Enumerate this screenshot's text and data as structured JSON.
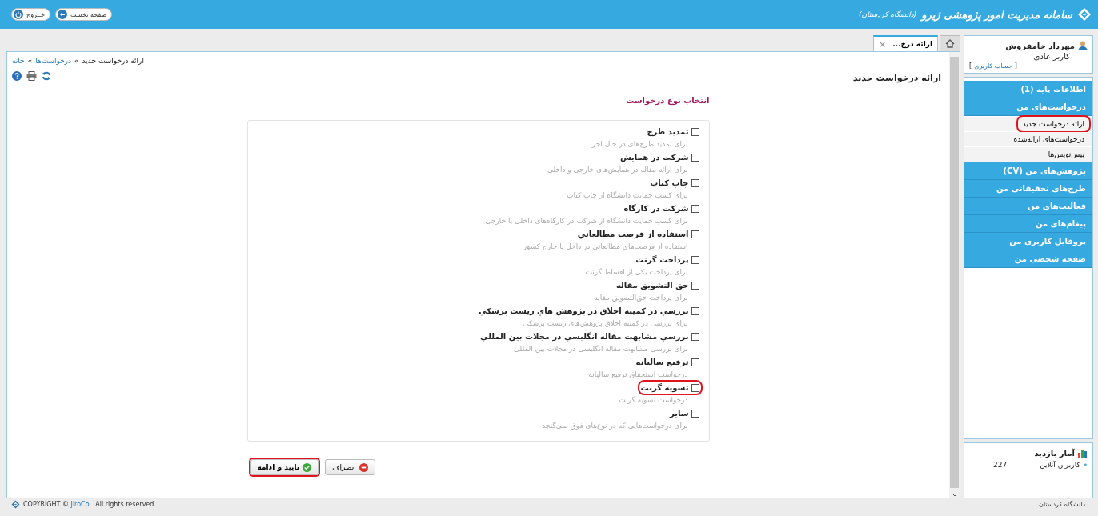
{
  "header": {
    "title": "سامانه مدیریت امور پژوهشی ژیرو",
    "subtitle": "(دانشگاه کردستان)",
    "buttons": [
      {
        "kind": "home",
        "label": "صفحه نخست"
      },
      {
        "kind": "logout",
        "label": "خــروج"
      }
    ]
  },
  "tabs": [
    {
      "kind": "home",
      "selected": false
    },
    {
      "kind": "page",
      "label": "ارائه درخ...",
      "close": "×",
      "selected": true
    }
  ],
  "breadcrumb": {
    "separator": "»",
    "items": [
      {
        "label": "ارائه درخواست جدید",
        "link": false
      },
      {
        "label": "درخواست‌ها",
        "link": true
      },
      {
        "label": "خانه",
        "link": true
      }
    ]
  },
  "page_title": "ارائه درخواست جدید",
  "section_title": "انتخاب نوع درخواست",
  "request_types": [
    {
      "title": "تمدید طرح",
      "description": "برای تمدید طرح‌های در حال اجرا",
      "checked": false,
      "highlighted": false
    },
    {
      "title": "شرکت در همایش",
      "description": "برای ارائه مقاله در همایش‌های خارجی و داخلی",
      "checked": false,
      "highlighted": false
    },
    {
      "title": "چاپ کتاب",
      "description": "برای کسب حمایت دانشگاه از چاپ کتاب",
      "checked": false,
      "highlighted": false
    },
    {
      "title": "شرکت در کارگاه",
      "description": "برای کسب حمایت دانشگاه از شرکت در کارگاه‌های داخلی یا خارجی",
      "checked": false,
      "highlighted": false
    },
    {
      "title": "استفاده از فرصت مطالعاتي",
      "description": "استفاده از فرصت‌های مطالعاتی در داخل یا خارج کشور",
      "checked": false,
      "highlighted": false
    },
    {
      "title": "پرداخت گرنت",
      "description": "برای پرداخت یکی از اقساط گرنت",
      "checked": false,
      "highlighted": false
    },
    {
      "title": "حق التشویق مقاله",
      "description": "برای پرداخت حق‌التشویق مقاله",
      "checked": false,
      "highlighted": false
    },
    {
      "title": "بررسي در کمیته اخلاق در پژوهش هاي زیست پزشکي",
      "description": "برای بررسی در کمیته اخلاق پژوهش‌های زیست پزشکی",
      "checked": false,
      "highlighted": false
    },
    {
      "title": "بررسي مشابهت مقاله انگلیسي در مجلات بین المللي",
      "description": "برای بررسی مشابهت مقاله انگلیسی در مجلات بین المللی",
      "checked": false,
      "highlighted": false
    },
    {
      "title": "ترفیع سالیانه",
      "description": "درخواست استحقاق ترفیع سالیانه",
      "checked": false,
      "highlighted": false
    },
    {
      "title": "تسویه گرنت",
      "description": "درخواست تسویه گرنت",
      "checked": false,
      "highlighted": true
    },
    {
      "title": "سایر",
      "description": "برای درخواست‌هایی که در نوع‌های فوق نمی‌گنجد",
      "checked": false,
      "highlighted": false
    }
  ],
  "actions": [
    {
      "kind": "cancel",
      "label": "انصراف",
      "highlighted": false
    },
    {
      "kind": "confirm",
      "label": "تایید و ادامه",
      "highlighted": true
    }
  ],
  "user": {
    "name": "مهرداد خامفروش",
    "role": "کاربر عادی",
    "account_link": "حساب کاربری",
    "bracket_open": "[",
    "bracket_close": "]"
  },
  "menu": [
    {
      "kind": "group",
      "label": "اطلاعات پایه (1)"
    },
    {
      "kind": "group",
      "label": "درخواست‌های من"
    },
    {
      "kind": "sub",
      "label": "ارائه درخواست جدید",
      "highlighted": true
    },
    {
      "kind": "sub",
      "label": "درخواست‌های ارائه‌شده",
      "highlighted": false
    },
    {
      "kind": "sub",
      "label": "پیش‌نویس‌ها",
      "highlighted": false
    },
    {
      "kind": "group",
      "label": "پژوهش‌های من (CV)"
    },
    {
      "kind": "group",
      "label": "طرح‌های تحقیقاتی من"
    },
    {
      "kind": "group",
      "label": "فعالیت‌های من"
    },
    {
      "kind": "group",
      "label": "پیغام‌های من"
    },
    {
      "kind": "group",
      "label": "پروفایل کاربری من"
    },
    {
      "kind": "group",
      "label": "صفحه شخصی من"
    }
  ],
  "stats": {
    "title": "آمار بازدید",
    "rows": [
      {
        "bullet": "•",
        "label": "کاربران آنلاین",
        "value": "227"
      }
    ]
  },
  "footer": {
    "copyright_prefix": "COPYRIGHT ©",
    "company": "JiroCo",
    "copyright_suffix": ". All rights reserved.",
    "university": "دانشگاه کردستان"
  }
}
